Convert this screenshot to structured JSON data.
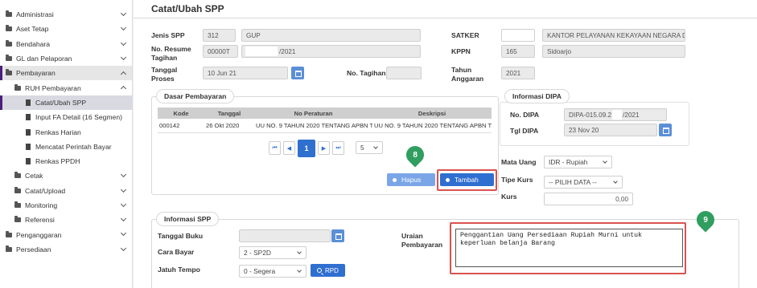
{
  "sidebar": {
    "items": [
      {
        "label": "Administrasi"
      },
      {
        "label": "Aset Tetap"
      },
      {
        "label": "Bendahara"
      },
      {
        "label": "GL dan Pelaporan"
      },
      {
        "label": "Pembayaran"
      },
      {
        "label": "RUH Pembayaran"
      },
      {
        "label": "Catat/Ubah SPP"
      },
      {
        "label": "Input FA Detail (16 Segmen)"
      },
      {
        "label": "Renkas Harian"
      },
      {
        "label": "Mencatat Perintah Bayar"
      },
      {
        "label": "Renkas PPDH"
      },
      {
        "label": "Cetak"
      },
      {
        "label": "Catat/Upload"
      },
      {
        "label": "Monitoring"
      },
      {
        "label": "Referensi"
      },
      {
        "label": "Penganggaran"
      },
      {
        "label": "Persediaan"
      }
    ]
  },
  "page": {
    "title": "Catat/Ubah SPP"
  },
  "form": {
    "jenis_spp_label": "Jenis SPP",
    "jenis_spp_code": "312",
    "jenis_spp_name": "GUP",
    "resume_label": "No. Resume Tagihan",
    "resume_prefix": "00000T",
    "resume_suffix": "/2021",
    "tgl_proses_label": "Tanggal Proses",
    "tgl_proses_value": "10 Jun 21",
    "no_tagihan_label": "No. Tagihan",
    "satker_label": "SATKER",
    "satker_name": "KANTOR PELAYANAN KEKAYAAN NEGARA D",
    "kppn_label": "KPPN",
    "kppn_code": "165",
    "kppn_name": "Sidoarjo",
    "tahun_label": "Tahun Anggaran",
    "tahun_value": "2021"
  },
  "dasar": {
    "title": "Dasar Pembayaran",
    "columns": [
      "Kode",
      "Tanggal",
      "No Peraturan",
      "Deskripsi"
    ],
    "rows": [
      [
        "000142",
        "26 Okt 2020",
        "UU NO. 9 TAHUN 2020 TENTANG APBN T.",
        "UU NO. 9 TAHUN 2020 TENTANG APBN T."
      ]
    ],
    "page_current": "1",
    "page_size": "5"
  },
  "buttons": {
    "hapus": "Hapus",
    "tambah": "Tambah",
    "rpd": "RPD"
  },
  "annotations": {
    "badge_8": "8",
    "badge_9": "9"
  },
  "dipa": {
    "title": "Informasi DIPA",
    "no_label": "No. DIPA",
    "no_prefix": "DIPA-015.09.2",
    "no_suffix": "/2021",
    "tgl_label": "Tgl DIPA",
    "tgl_value": "23 Nov 20"
  },
  "kurs": {
    "mata_uang_label": "Mata Uang",
    "mata_uang_value": "IDR - Rupiah",
    "tipe_label": "Tipe Kurs",
    "tipe_value": "-- PILIH DATA --",
    "kurs_label": "Kurs",
    "kurs_value": "0,00"
  },
  "spp": {
    "title": "Informasi SPP",
    "tgl_buku_label": "Tanggal Buku",
    "cara_bayar_label": "Cara Bayar",
    "cara_bayar_value": "2 - SP2D",
    "jatuh_tempo_label": "Jatuh Tempo",
    "jatuh_tempo_value": "0 - Segera",
    "uraian_label": "Uraian Pembayaran",
    "uraian_value": "Penggantian Uang Persediaan Rupiah Murni untuk keperluan belanja Barang"
  },
  "colors": {
    "accent": "#2f6fd0",
    "highlight": "#d9534f",
    "badge": "#2f9e5f",
    "active_bar": "#4b1f7a"
  }
}
